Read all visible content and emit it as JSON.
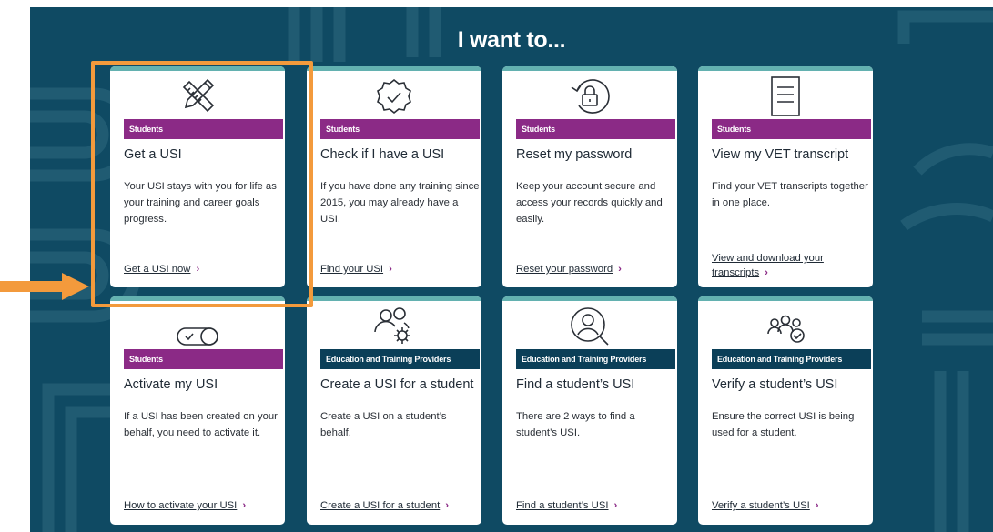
{
  "page": {
    "heading": "I want to..."
  },
  "colors": {
    "background": "#0f4a63",
    "students_badge": "#8b2a86",
    "providers_badge": "#0b3f58",
    "card_strip": "#63b1b0",
    "highlight": "#f39a3c",
    "chevron": "#8b2a86"
  },
  "cards": [
    {
      "icon": "pencil-ruler-icon",
      "badge": "Students",
      "title": "Get a USI",
      "description": "Your USI stays with you for life as your training and career goals progress.",
      "link": "Get a USI now",
      "chevron": "›"
    },
    {
      "icon": "verified-badge-icon",
      "badge": "Students",
      "title": "Check if I have a USI",
      "description": "If you have done any training since 2015, you may already have a USI.",
      "link": "Find your USI",
      "chevron": "›"
    },
    {
      "icon": "reset-lock-icon",
      "badge": "Students",
      "title": "Reset my password",
      "description": "Keep your account secure and access your records quickly and easily.",
      "link": "Reset your password",
      "chevron": "›"
    },
    {
      "icon": "document-icon",
      "badge": "Students",
      "title": "View my VET transcript",
      "description": "Find your VET transcripts together in one place.",
      "link_line1": "View and download your",
      "link_line2": "transcripts",
      "chevron": "›"
    },
    {
      "icon": "toggle-icon",
      "badge": "Students",
      "title": "Activate my USI",
      "description": "If a USI has been created on your behalf, you need to activate it.",
      "link": "How to activate your USI",
      "chevron": "›"
    },
    {
      "icon": "users-gear-icon",
      "badge": "Education and Training Providers",
      "title": "Create a USI for a student",
      "description": "Create a USI on a student’s behalf.",
      "link": "Create a USI for a student",
      "chevron": "›"
    },
    {
      "icon": "user-search-icon",
      "badge": "Education and Training Providers",
      "title": "Find a student’s USI",
      "description": "There are 2 ways to find a student’s USI.",
      "link": "Find a student’s USI",
      "chevron": "›"
    },
    {
      "icon": "group-check-icon",
      "badge": "Education and Training Providers",
      "title": "Verify a student’s USI",
      "description": "Ensure the correct USI is being used for a student.",
      "link": "Verify a student’s USI",
      "chevron": "›"
    }
  ]
}
